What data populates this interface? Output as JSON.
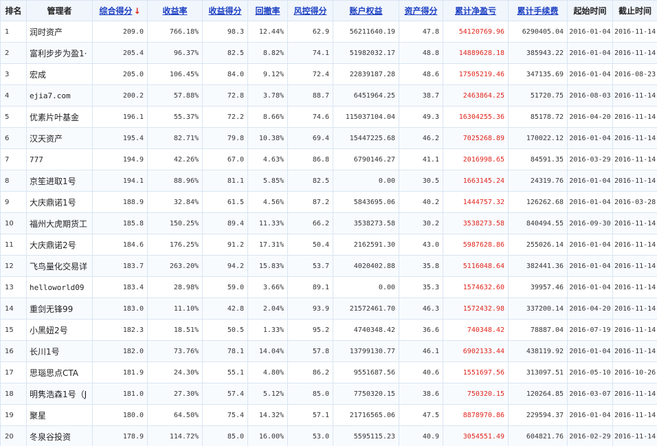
{
  "headers": {
    "rank": "排名",
    "manager": "管理者",
    "composite": "综合得分",
    "return_rate": "收益率",
    "return_score": "收益得分",
    "drawdown": "回撤率",
    "risk_score": "风控得分",
    "equity": "账户权益",
    "asset_score": "资产得分",
    "net_pnl": "累计净盈亏",
    "fees": "累计手续费",
    "start": "起始时间",
    "end": "截止时间"
  },
  "sort_arrow": "↓",
  "rows": [
    {
      "rank": "1",
      "manager": "润时资产",
      "composite": "209.0",
      "return_rate": "766.18%",
      "return_score": "98.3",
      "drawdown": "12.44%",
      "risk_score": "62.9",
      "equity": "56211640.19",
      "asset_score": "47.8",
      "net_pnl": "54120769.96",
      "fees": "6290405.04",
      "start": "2016-01-04",
      "end": "2016-11-14"
    },
    {
      "rank": "2",
      "manager": "富利步步为盈1·",
      "composite": "205.4",
      "return_rate": "96.37%",
      "return_score": "82.5",
      "drawdown": "8.82%",
      "risk_score": "74.1",
      "equity": "51982032.17",
      "asset_score": "48.8",
      "net_pnl": "14889628.18",
      "fees": "385943.22",
      "start": "2016-01-04",
      "end": "2016-11-14"
    },
    {
      "rank": "3",
      "manager": "宏成",
      "composite": "205.0",
      "return_rate": "106.45%",
      "return_score": "84.0",
      "drawdown": "9.12%",
      "risk_score": "72.4",
      "equity": "22839187.28",
      "asset_score": "48.6",
      "net_pnl": "17505219.46",
      "fees": "347135.69",
      "start": "2016-01-04",
      "end": "2016-08-23"
    },
    {
      "rank": "4",
      "manager": "ejia7.com",
      "composite": "200.2",
      "return_rate": "57.88%",
      "return_score": "72.8",
      "drawdown": "3.78%",
      "risk_score": "88.7",
      "equity": "6451964.25",
      "asset_score": "38.7",
      "net_pnl": "2463864.25",
      "fees": "51720.75",
      "start": "2016-08-03",
      "end": "2016-11-14",
      "mono": true
    },
    {
      "rank": "5",
      "manager": "优素片叶基金",
      "composite": "196.1",
      "return_rate": "55.37%",
      "return_score": "72.2",
      "drawdown": "8.66%",
      "risk_score": "74.6",
      "equity": "115037104.04",
      "asset_score": "49.3",
      "net_pnl": "16304255.36",
      "fees": "85178.72",
      "start": "2016-04-20",
      "end": "2016-11-14"
    },
    {
      "rank": "6",
      "manager": "汉天资产",
      "composite": "195.4",
      "return_rate": "82.71%",
      "return_score": "79.8",
      "drawdown": "10.38%",
      "risk_score": "69.4",
      "equity": "15447225.68",
      "asset_score": "46.2",
      "net_pnl": "7025268.89",
      "fees": "170022.12",
      "start": "2016-01-04",
      "end": "2016-11-14"
    },
    {
      "rank": "7",
      "manager": "777",
      "composite": "194.9",
      "return_rate": "42.26%",
      "return_score": "67.0",
      "drawdown": "4.63%",
      "risk_score": "86.8",
      "equity": "6790146.27",
      "asset_score": "41.1",
      "net_pnl": "2016998.65",
      "fees": "84591.35",
      "start": "2016-03-29",
      "end": "2016-11-14",
      "mono": true
    },
    {
      "rank": "8",
      "manager": "京笙进取1号",
      "composite": "194.1",
      "return_rate": "88.96%",
      "return_score": "81.1",
      "drawdown": "5.85%",
      "risk_score": "82.5",
      "equity": "0.00",
      "asset_score": "30.5",
      "net_pnl": "1663145.24",
      "fees": "24319.76",
      "start": "2016-01-04",
      "end": "2016-11-14"
    },
    {
      "rank": "9",
      "manager": "大庆鼎诺1号",
      "composite": "188.9",
      "return_rate": "32.84%",
      "return_score": "61.5",
      "drawdown": "4.56%",
      "risk_score": "87.2",
      "equity": "5843695.06",
      "asset_score": "40.2",
      "net_pnl": "1444757.32",
      "fees": "126262.68",
      "start": "2016-01-04",
      "end": "2016-03-28"
    },
    {
      "rank": "10",
      "manager": "福州大虎期货工",
      "composite": "185.8",
      "return_rate": "150.25%",
      "return_score": "89.4",
      "drawdown": "11.33%",
      "risk_score": "66.2",
      "equity": "3538273.58",
      "asset_score": "30.2",
      "net_pnl": "3538273.58",
      "fees": "840494.55",
      "start": "2016-09-30",
      "end": "2016-11-14"
    },
    {
      "rank": "11",
      "manager": "大庆鼎诺2号",
      "composite": "184.6",
      "return_rate": "176.25%",
      "return_score": "91.2",
      "drawdown": "17.31%",
      "risk_score": "50.4",
      "equity": "2162591.30",
      "asset_score": "43.0",
      "net_pnl": "5987628.86",
      "fees": "255026.14",
      "start": "2016-01-04",
      "end": "2016-11-14"
    },
    {
      "rank": "12",
      "manager": "飞鸟量化交易详",
      "composite": "183.7",
      "return_rate": "263.20%",
      "return_score": "94.2",
      "drawdown": "15.83%",
      "risk_score": "53.7",
      "equity": "4020402.88",
      "asset_score": "35.8",
      "net_pnl": "5116048.64",
      "fees": "382441.36",
      "start": "2016-01-04",
      "end": "2016-11-14"
    },
    {
      "rank": "13",
      "manager": "helloworld09",
      "composite": "183.4",
      "return_rate": "28.98%",
      "return_score": "59.0",
      "drawdown": "3.66%",
      "risk_score": "89.1",
      "equity": "0.00",
      "asset_score": "35.3",
      "net_pnl": "1574632.60",
      "fees": "39957.46",
      "start": "2016-01-04",
      "end": "2016-11-14",
      "mono": true
    },
    {
      "rank": "14",
      "manager": "重剑无锋99",
      "composite": "183.0",
      "return_rate": "11.10%",
      "return_score": "42.8",
      "drawdown": "2.04%",
      "risk_score": "93.9",
      "equity": "21572461.70",
      "asset_score": "46.3",
      "net_pnl": "1572432.98",
      "fees": "337200.14",
      "start": "2016-04-20",
      "end": "2016-11-14"
    },
    {
      "rank": "15",
      "manager": "小黑妞2号",
      "composite": "182.3",
      "return_rate": "18.51%",
      "return_score": "50.5",
      "drawdown": "1.33%",
      "risk_score": "95.2",
      "equity": "4740348.42",
      "asset_score": "36.6",
      "net_pnl": "740348.42",
      "fees": "78887.04",
      "start": "2016-07-19",
      "end": "2016-11-14"
    },
    {
      "rank": "16",
      "manager": "长川1号",
      "composite": "182.0",
      "return_rate": "73.76%",
      "return_score": "78.1",
      "drawdown": "14.04%",
      "risk_score": "57.8",
      "equity": "13799130.77",
      "asset_score": "46.1",
      "net_pnl": "6902133.44",
      "fees": "438119.92",
      "start": "2016-01-04",
      "end": "2016-11-14"
    },
    {
      "rank": "17",
      "manager": "思瑙思点CTA",
      "composite": "181.9",
      "return_rate": "24.30%",
      "return_score": "55.1",
      "drawdown": "4.80%",
      "risk_score": "86.2",
      "equity": "9551687.56",
      "asset_score": "40.6",
      "net_pnl": "1551697.56",
      "fees": "313097.51",
      "start": "2016-05-10",
      "end": "2016-10-26"
    },
    {
      "rank": "18",
      "manager": "明隽浩森1号（J",
      "composite": "181.0",
      "return_rate": "27.30%",
      "return_score": "57.4",
      "drawdown": "5.12%",
      "risk_score": "85.0",
      "equity": "7750320.15",
      "asset_score": "38.6",
      "net_pnl": "750320.15",
      "fees": "120264.85",
      "start": "2016-03-07",
      "end": "2016-11-14"
    },
    {
      "rank": "19",
      "manager": "聚星",
      "composite": "180.0",
      "return_rate": "64.50%",
      "return_score": "75.4",
      "drawdown": "14.32%",
      "risk_score": "57.1",
      "equity": "21716565.06",
      "asset_score": "47.5",
      "net_pnl": "8878970.86",
      "fees": "229594.37",
      "start": "2016-01-04",
      "end": "2016-11-14"
    },
    {
      "rank": "20",
      "manager": "冬泉谷投资",
      "composite": "178.9",
      "return_rate": "114.72%",
      "return_score": "85.0",
      "drawdown": "16.00%",
      "risk_score": "53.0",
      "equity": "5595115.23",
      "asset_score": "40.9",
      "net_pnl": "3054551.49",
      "fees": "604821.76",
      "start": "2016-02-29",
      "end": "2016-11-14"
    }
  ]
}
